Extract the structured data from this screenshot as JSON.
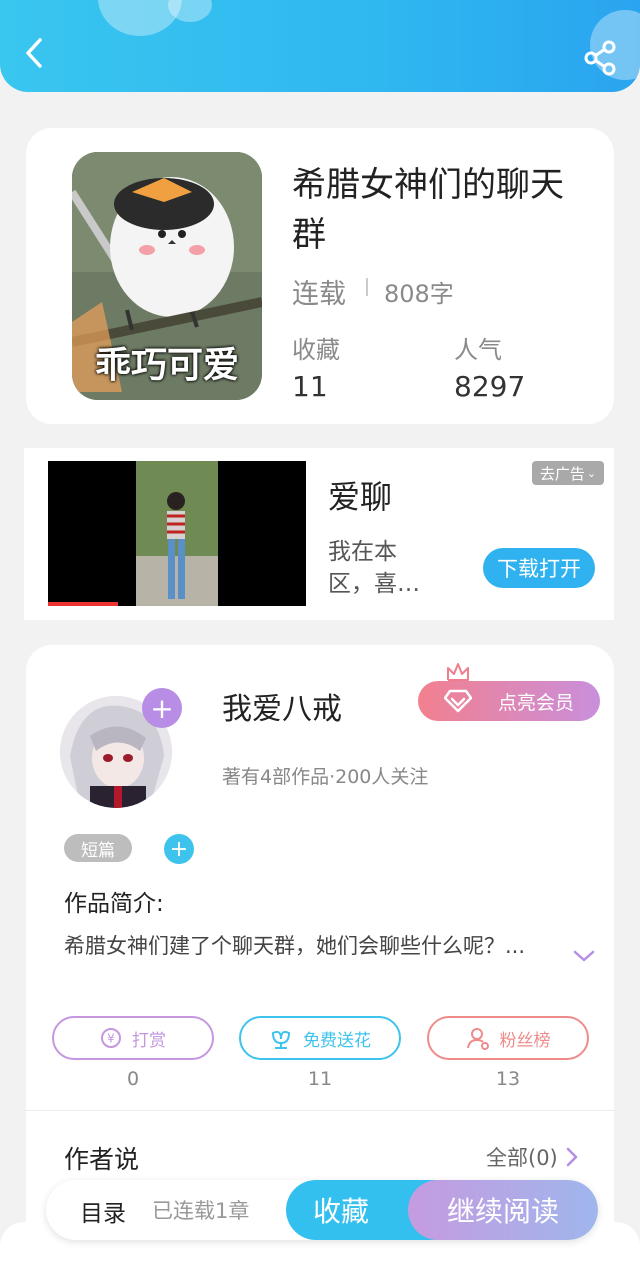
{
  "header": {
    "back_icon": "back-icon",
    "share_icon": "share-icon"
  },
  "book": {
    "title": "希腊女神们的聊天群",
    "status": "连载",
    "word_count": "808字",
    "favorites_label": "收藏",
    "favorites_value": "11",
    "popularity_label": "人气",
    "popularity_value": "8297",
    "cover_caption": "乖巧可爱"
  },
  "ad": {
    "tag": "去广告",
    "title": "爱聊",
    "desc": "我在本区，喜…",
    "button": "下载打开"
  },
  "author": {
    "name": "我爱八戒",
    "info": "著有4部作品·200人关注",
    "vip_label": "点亮会员",
    "tag": "短篇"
  },
  "intro": {
    "label": "作品简介:",
    "text": "希腊女神们建了个聊天群，她们会聊些什么呢？..."
  },
  "actions": [
    {
      "label": "打赏",
      "count": "0",
      "color": "#c497e0"
    },
    {
      "label": "免费送花",
      "count": "11",
      "color": "#3ec3ec"
    },
    {
      "label": "粉丝榜",
      "count": "13",
      "color": "#ef8b8b"
    }
  ],
  "author_says": {
    "label": "作者说",
    "all": "全部(0)"
  },
  "bottom_bar": {
    "toc": "目录",
    "chapters": "已连载1章",
    "favorite": "收藏",
    "continue": "继续阅读"
  }
}
